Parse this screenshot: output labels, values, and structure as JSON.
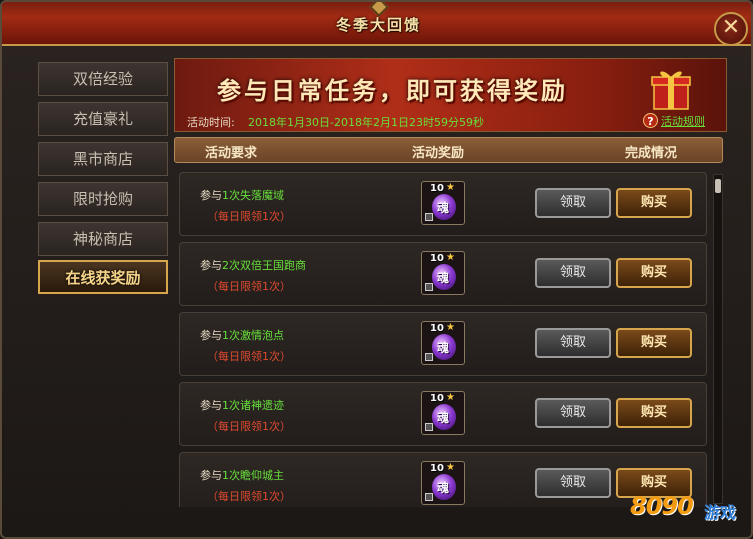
{
  "window": {
    "title": "冬季大回馈",
    "close_symbol": "✕"
  },
  "sidebar": {
    "items": [
      {
        "label": "双倍经验",
        "active": false
      },
      {
        "label": "充值豪礼",
        "active": false
      },
      {
        "label": "黑市商店",
        "active": false
      },
      {
        "label": "限时抢购",
        "active": false
      },
      {
        "label": "神秘商店",
        "active": false
      },
      {
        "label": "在线获奖励",
        "active": true
      }
    ]
  },
  "banner": {
    "headline": "参与日常任务，即可获得奖励",
    "time_label": "活动时间:",
    "time_value": "2018年1月30日-2018年2月1日23时59分59秒",
    "rules_icon": "?",
    "rules_label": "活动规则"
  },
  "columns": {
    "requirement": "活动要求",
    "reward": "活动奖励",
    "status": "完成情况"
  },
  "tasks": [
    {
      "prefix": "参与",
      "activity": "1次失落魔域",
      "limit": "（每日限领1次）",
      "reward_count": "10",
      "reward_glyph": "魂",
      "claim": "领取",
      "buy": "购买"
    },
    {
      "prefix": "参与",
      "activity": "2次双倍王国跑商",
      "limit": "（每日限领1次）",
      "reward_count": "10",
      "reward_glyph": "魂",
      "claim": "领取",
      "buy": "购买"
    },
    {
      "prefix": "参与",
      "activity": "1次激情泡点",
      "limit": "（每日限领1次）",
      "reward_count": "10",
      "reward_glyph": "魂",
      "claim": "领取",
      "buy": "购买"
    },
    {
      "prefix": "参与",
      "activity": "1次诸神遗迹",
      "limit": "（每日限领1次）",
      "reward_count": "10",
      "reward_glyph": "魂",
      "claim": "领取",
      "buy": "购买"
    },
    {
      "prefix": "参与",
      "activity": "1次瞻仰城主",
      "limit": "（每日限领1次）",
      "reward_count": "10",
      "reward_glyph": "魂",
      "claim": "领取",
      "buy": "购买"
    }
  ],
  "watermark": {
    "number": "8090",
    "word": "游戏"
  },
  "colors": {
    "accent_green": "#67e03a",
    "limit_red": "#e04a30",
    "gold": "#d6a54c",
    "title_red": "#a22b14"
  }
}
